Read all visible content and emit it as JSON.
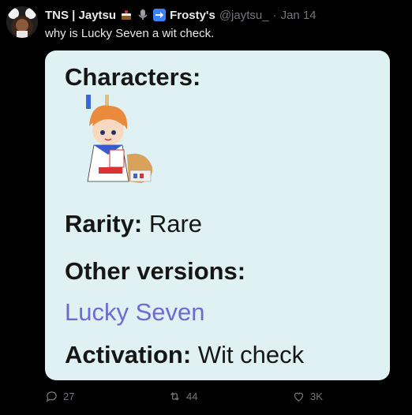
{
  "tweet": {
    "author_name": "TNS | Jaytsu",
    "extra_label": "Frosty's",
    "handle": "@jaytsu_",
    "separator": "·",
    "date": "Jan 14",
    "text": "why is Lucky Seven a wit check."
  },
  "card": {
    "characters_label": "Characters:",
    "rarity_label": "Rarity:",
    "rarity_value": "Rare",
    "other_versions_label": "Other versions:",
    "other_versions_link": "Lucky Seven",
    "activation_label": "Activation:",
    "activation_value": "Wit check",
    "link_color": "#6f6ad3",
    "background": "#dff1f2"
  },
  "actions": {
    "replies": "27",
    "retweets": "44",
    "likes": "3K"
  },
  "icons": [
    "avatar",
    "cake-emoji-icon",
    "microphone-emoji-icon",
    "right-arrow-emoji-icon",
    "reply-icon",
    "retweet-icon",
    "like-icon"
  ]
}
